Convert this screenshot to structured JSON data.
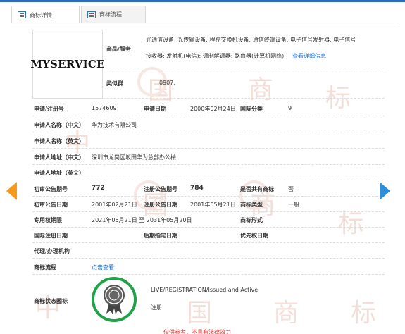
{
  "tabs": [
    {
      "label": "商标详情",
      "icon": "document-icon"
    },
    {
      "label": "商标流程",
      "icon": "list-icon"
    }
  ],
  "logo_text": "MYSERVICE",
  "goods_services": {
    "label": "商品/服务",
    "line1": "光通信设备; 光传输设备; 程控交换机设备; 通信终端设备; 电子信号发射器; 电子信号",
    "line2": "接收器; 发射机(电信); 调制解调器; 路由器(计算机网络);",
    "link": "查看详细信息"
  },
  "similar_group": {
    "label": "类似群",
    "value": "0907;"
  },
  "reg_no": {
    "label": "申请/注册号",
    "value": "1574609"
  },
  "apply_date": {
    "label": "申请日期",
    "value": "2000年02月24日"
  },
  "intl_class": {
    "label": "国际分类",
    "value": "9"
  },
  "applicant_cn": {
    "label": "申请人名称（中文）",
    "value": "华为技术有限公司"
  },
  "applicant_en": {
    "label": "申请人名称（英文）",
    "value": ""
  },
  "address_cn": {
    "label": "申请人地址（中文）",
    "value": "深圳市龙岗区坂田华为总部办公楼"
  },
  "address_en": {
    "label": "申请人地址（英文）",
    "value": ""
  },
  "prelim_no": {
    "label": "初审公告期号",
    "value": "772"
  },
  "reg_notice_no": {
    "label": "注册公告期号",
    "value": "784"
  },
  "shared": {
    "label": "是否共有商标",
    "value": "否"
  },
  "prelim_date": {
    "label": "初审公告日期",
    "value": "2001年02月21日"
  },
  "reg_notice_date": {
    "label": "注册公告日期",
    "value": "2001年05月21日"
  },
  "mark_type": {
    "label": "商标类型",
    "value": "一般"
  },
  "exclusive_period": {
    "label": "专用权期限",
    "value": "2021年05月21日 至 2031年05月20日"
  },
  "mark_form": {
    "label": "商标形式",
    "value": ""
  },
  "intl_reg_date": {
    "label": "国际注册日期",
    "value": ""
  },
  "later_date": {
    "label": "后期指定日期",
    "value": ""
  },
  "priority_date": {
    "label": "优先权日期",
    "value": ""
  },
  "agent": {
    "label": "代理/办理机构",
    "value": ""
  },
  "process": {
    "label": "商标流程",
    "link": "点击查看"
  },
  "status": {
    "label": "商标状态图标",
    "line1": "LIVE/REGISTRATION/Issued and Active",
    "line2": "注册"
  },
  "notice_red": "仅供参考，不具有法律效力",
  "colors": {
    "accent": "#2f73c8",
    "link": "#1f6ad1",
    "status": "#20a348",
    "arrow_left": "#f39a1a",
    "arrow_right": "#2f8ed9",
    "warning": "#e53935"
  },
  "watermark_chars": [
    "中",
    "国",
    "商",
    "标"
  ]
}
